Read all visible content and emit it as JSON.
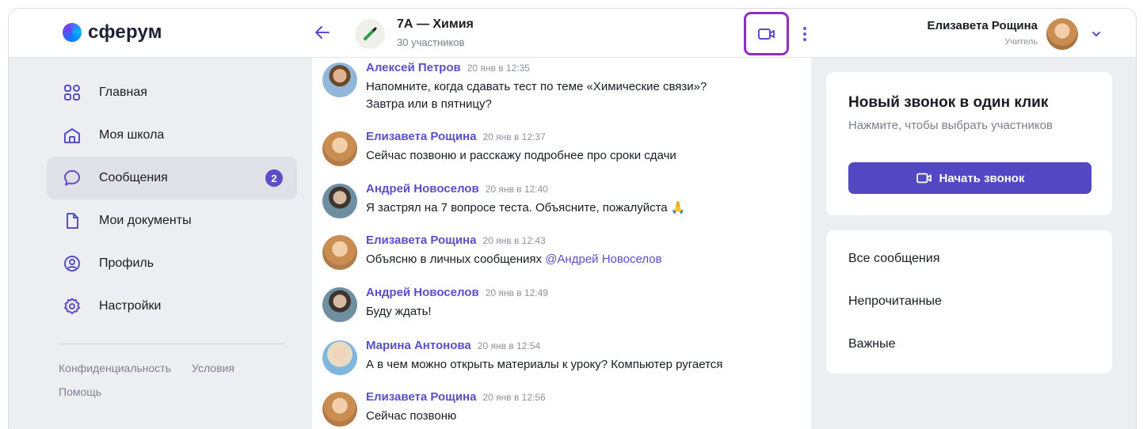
{
  "brand": {
    "name": "сферум"
  },
  "chat_header": {
    "title": "7А — Химия",
    "subtitle": "30 участников"
  },
  "user": {
    "name": "Елизавета Рощина",
    "role": "Учитель"
  },
  "sidebar": {
    "items": [
      {
        "label": "Главная",
        "icon": "home-grid-icon"
      },
      {
        "label": "Моя школа",
        "icon": "school-icon"
      },
      {
        "label": "Сообщения",
        "icon": "chat-bubble-icon",
        "badge": "2",
        "active": true
      },
      {
        "label": "Мои документы",
        "icon": "document-icon"
      },
      {
        "label": "Профиль",
        "icon": "profile-icon"
      },
      {
        "label": "Настройки",
        "icon": "settings-icon"
      }
    ],
    "footer": {
      "privacy": "Конфиденциальность",
      "terms": "Условия",
      "help": "Помощь"
    }
  },
  "messages": [
    {
      "author": "Алексей Петров",
      "time": "20 янв в 12:35",
      "lines": [
        "Напомните, когда сдавать тест по теме «Химические связи»?",
        "Завтра или в пятницу?"
      ]
    },
    {
      "author": "Елизавета Рощина",
      "time": "20 янв в 12:37",
      "lines": [
        "Сейчас позвоню и расскажу подробнее про сроки сдачи"
      ]
    },
    {
      "author": "Андрей Новоселов",
      "time": "20 янв в 12:40",
      "lines": [
        "Я застрял на 7 вопросе теста. Объясните, пожалуйста 🙏"
      ]
    },
    {
      "author": "Елизавета Рощина",
      "time": "20 янв в 12:43",
      "text_before": "Объясню в личных сообщениях",
      "mention": "@Андрей Новоселов"
    },
    {
      "author": "Андрей Новоселов",
      "time": "20 янв в 12:49",
      "lines": [
        "Буду ждать!"
      ]
    },
    {
      "author": "Марина Антонова",
      "time": "20 янв в 12:54",
      "lines": [
        "А в чем можно открыть материалы к уроку? Компьютер ругается"
      ]
    },
    {
      "author": "Елизавета Рощина",
      "time": "20 янв в 12:56",
      "lines": [
        "Сейчас позвоню"
      ]
    }
  ],
  "call_card": {
    "title": "Новый звонок в один клик",
    "subtitle": "Нажмите, чтобы выбрать участников",
    "button_label": "Начать звонок"
  },
  "filters": {
    "all": "Все сообщения",
    "unread": "Непрочитанные",
    "important": "Важные"
  },
  "colors": {
    "accent": "#5a4fc9",
    "highlight_frame": "#8e2ec7",
    "badge": "#5a4fc9"
  }
}
